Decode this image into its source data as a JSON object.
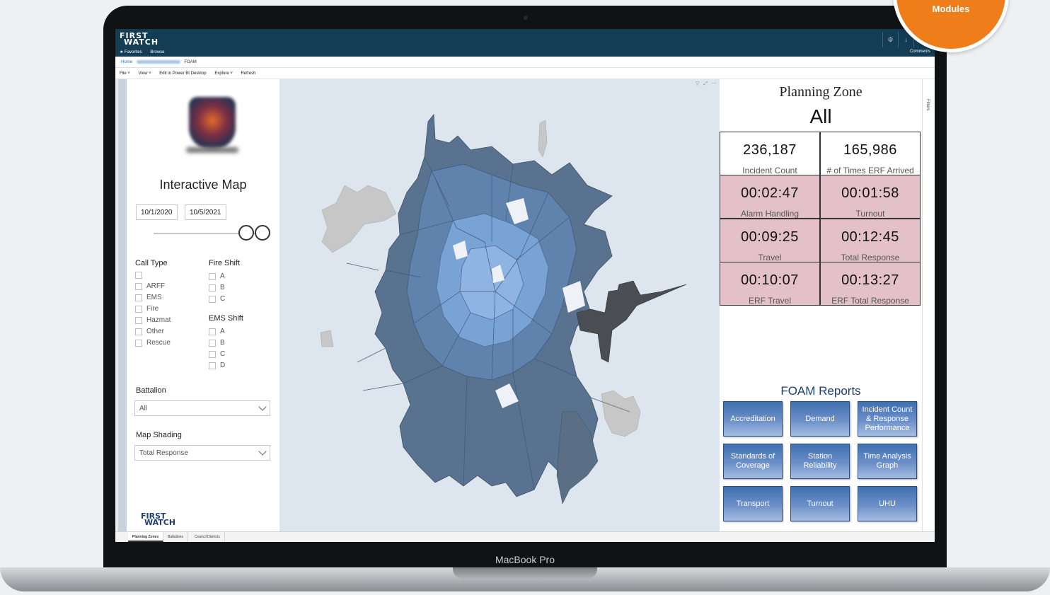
{
  "badge": {
    "label": "Modules"
  },
  "device": {
    "label": "MacBook Pro"
  },
  "app": {
    "logo_line1": "FIRST",
    "logo_line2": "WATCH",
    "favorites": "★ Favorites",
    "browse": "Browse",
    "comments": "Comments",
    "top_icons": [
      "gear-icon",
      "download-icon",
      "help-icon"
    ]
  },
  "breadcrumb": {
    "home": "Home",
    "current": "FOAM"
  },
  "toolbar": {
    "file": "File ˅",
    "view": "View ˅",
    "edit": "Edit in Power BI Desktop",
    "explore": "Explore ˅",
    "refresh": "Refresh"
  },
  "slicer": {
    "title": "Interactive Map",
    "date_start": "10/1/2020",
    "date_end": "10/5/2021",
    "call_type_title": "Call Type",
    "call_types": [
      "",
      "ARFF",
      "EMS",
      "Fire",
      "Hazmat",
      "Other",
      "Rescue"
    ],
    "fire_shift_title": "Fire Shift",
    "fire_shifts": [
      "A",
      "B",
      "C"
    ],
    "ems_shift_title": "EMS Shift",
    "ems_shifts": [
      "A",
      "B",
      "C",
      "D"
    ],
    "battalion_title": "Battalion",
    "battalion_value": "All",
    "map_shading_title": "Map Shading",
    "map_shading_value": "Total Response"
  },
  "kpi": {
    "title": "Planning Zone",
    "zone": "All",
    "cards": [
      {
        "value": "236,187",
        "label": "Incident Count",
        "style": "white"
      },
      {
        "value": "165,986",
        "label": "# of Times ERF Arrived",
        "style": "white"
      },
      {
        "value": "00:02:47",
        "label": "Alarm Handling",
        "style": "pink"
      },
      {
        "value": "00:01:58",
        "label": "Turnout",
        "style": "pink"
      },
      {
        "value": "00:09:25",
        "label": "Travel",
        "style": "pink"
      },
      {
        "value": "00:12:45",
        "label": "Total Response",
        "style": "pink"
      },
      {
        "value": "00:10:07",
        "label": "ERF Travel",
        "style": "pink"
      },
      {
        "value": "00:13:27",
        "label": "ERF Total Response",
        "style": "pink"
      }
    ]
  },
  "reports": {
    "title": "FOAM Reports",
    "buttons": [
      "Accreditation",
      "Demand",
      "Incident Count & Response Performance",
      "Standards of Coverage",
      "Station Reliability",
      "Time Analysis Graph",
      "Transport",
      "Turnout",
      "UHU"
    ]
  },
  "filters_label": "Filters",
  "tabs": [
    "Planning Zones",
    "Battalions",
    "Council Districts"
  ],
  "colors": {
    "header": "#123d55",
    "kpi_pink": "#e4c1c8",
    "report_button": "#3f6fb0",
    "badge": "#ef7d1a",
    "map_light": "#7fa9d9",
    "map_dark": "#4d6a88"
  }
}
